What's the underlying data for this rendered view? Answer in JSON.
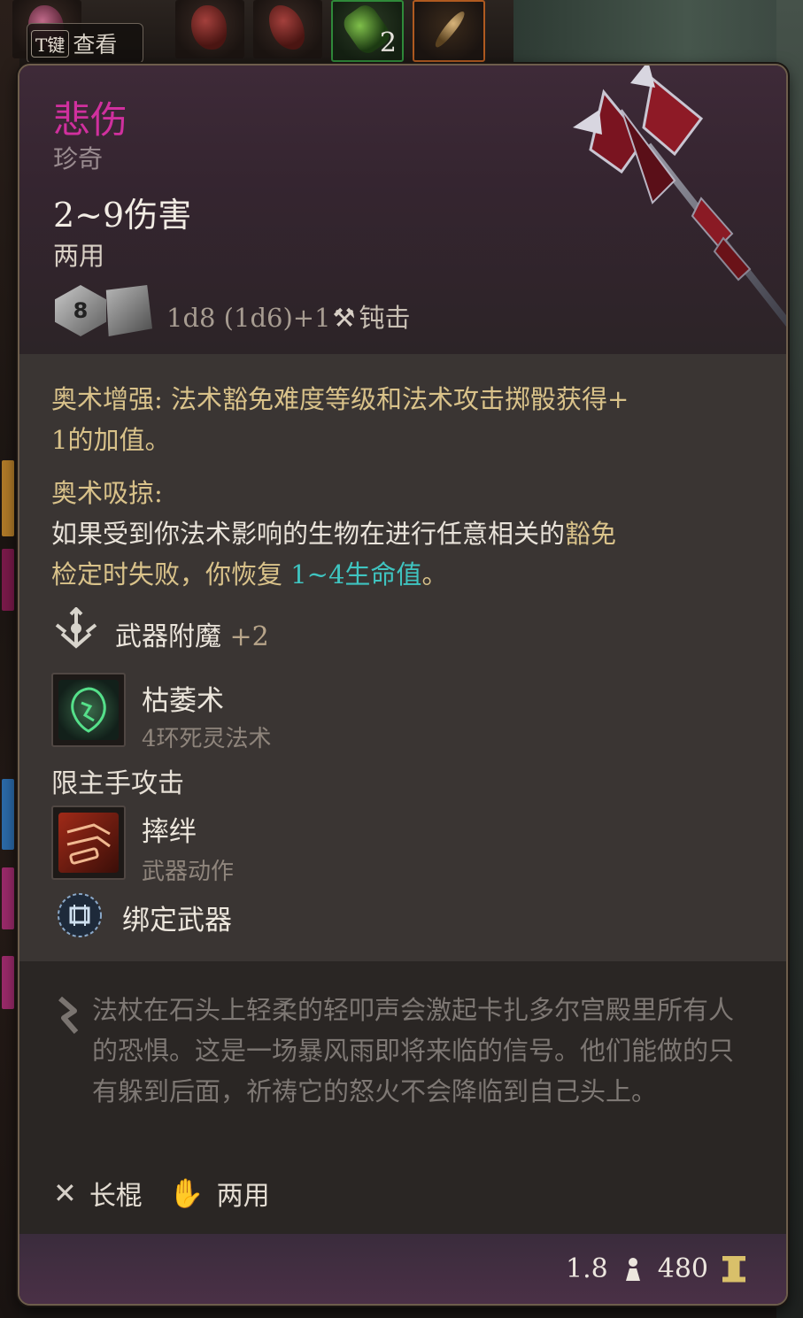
{
  "inventory": {
    "t_key_label": "T键",
    "inspect_label": "查看",
    "stack_count": "2"
  },
  "item": {
    "name": "悲伤",
    "rarity": "珍奇",
    "damage": "2~9伤害",
    "handedness": "两用",
    "die_primary": "8",
    "dice_formula": "1d8 (1d6)+1",
    "damage_type": "钝击",
    "name_color": "#d0309e"
  },
  "properties": {
    "arcane_enhance_label": "奥术增强:",
    "arcane_enhance_text_1": "法术豁免难度等级和法术攻击掷骰获得+",
    "arcane_enhance_text_2": "1的加值。",
    "arcane_drain_label": "奥术吸掠:",
    "arcane_drain_text_1": "如果受到你法术影响的生物在进行任意相关的",
    "arcane_drain_text_1b": "豁免",
    "arcane_drain_text_2a": "检定时失败，你恢复",
    "arcane_drain_value": "1~4生命值",
    "arcane_drain_text_2b": "。",
    "enchant_label": "武器附魔",
    "enchant_value": "+2"
  },
  "abilities": [
    {
      "title": "枯萎术",
      "subtitle": "4环死灵法术",
      "icon": "blight-icon"
    },
    {
      "section": "限主手攻击"
    },
    {
      "title": "摔绊",
      "subtitle": "武器动作",
      "icon": "topple-icon"
    },
    {
      "title": "绑定武器",
      "icon": "bind-weapon-icon"
    }
  ],
  "flavor": {
    "text": "法杖在石头上轻柔的轻叩声会激起卡扎多尔宫殿里所有人的恐惧。这是一场暴风雨即将来临的信号。他们能做的只有躲到后面，祈祷它的怒火不会降临到自己头上。"
  },
  "tags": {
    "weapon_type": "长棍",
    "handedness": "两用"
  },
  "footer": {
    "weight": "1.8",
    "value": "480"
  }
}
